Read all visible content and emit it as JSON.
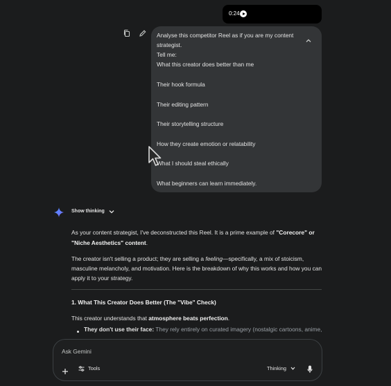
{
  "video": {
    "timestamp": "0:24"
  },
  "prompt": {
    "lines": [
      "Analyse this competitor Reel as if you are my content",
      "strategist.",
      "Tell me:",
      "What this creator does better than me",
      "Their hook formula",
      "Their editing pattern",
      "Their storytelling structure",
      "How they create emotion or relatability",
      "What I should steal ethically",
      "What beginners can learn immediately."
    ]
  },
  "response": {
    "show_thinking_label": "Show thinking",
    "p1_line1_pre": "As your content strategist, I've deconstructed this Reel. It is a prime example of ",
    "p1_line1_bold": "\"Corecore\" or",
    "p1_line2_bold": "\"Niche Aesthetics\" content",
    "p1_line2_post": ".",
    "p2_line1_pre": "The creator isn't selling a product; they are selling a ",
    "p2_line1_italic": "feeling",
    "p2_line1_post": "—specifically, a mix of stoicism,",
    "p2_line2": "masculine melancholy, and motivation. Here is the breakdown of why this works and how you can",
    "p2_line3": "apply it to your strategy.",
    "section_heading": "1. What This Creator Does Better (The \"Vibe\" Check)",
    "p3_pre": "This creator understands that ",
    "p3_bold": "atmosphere beats perfection",
    "p3_post": ".",
    "bullet_bold": "They don't use their face:",
    "bullet_rest": " They rely entirely on curated imagery (nostalgic cartoons, anime,"
  },
  "input": {
    "placeholder": "Ask Gemini",
    "tools_label": "Tools",
    "mode_label": "Thinking"
  },
  "colors": {
    "background": "#1b1c1d",
    "prompt_bubble": "#333537",
    "accent_sparkle": "#4b90ff"
  }
}
